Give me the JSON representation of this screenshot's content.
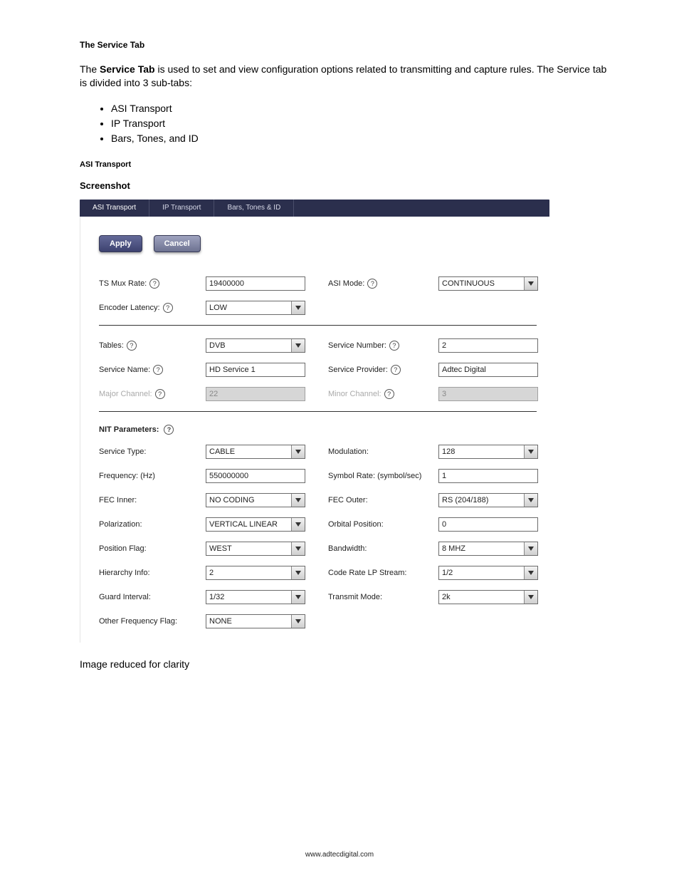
{
  "headings": {
    "section": "The Service Tab",
    "intro_pre": "The ",
    "intro_bold": "Service Tab",
    "intro_post": " is used to set and view configuration options related to transmitting and capture rules. The Service tab is divided into 3 sub-tabs:",
    "subtabs": [
      "ASI Transport",
      "IP Transport",
      "Bars, Tones, and ID"
    ],
    "subheading": "ASI Transport",
    "screenshot": "Screenshot",
    "caption": "Image reduced for clarity"
  },
  "tabs": {
    "asi": "ASI Transport",
    "ip": "IP Transport",
    "bars": "Bars, Tones & ID"
  },
  "buttons": {
    "apply": "Apply",
    "cancel": "Cancel"
  },
  "block1": {
    "ts_mux_rate": {
      "label": "TS Mux Rate:",
      "value": "19400000"
    },
    "asi_mode": {
      "label": "ASI Mode:",
      "value": "CONTINUOUS"
    },
    "encoder_latency": {
      "label": "Encoder Latency:",
      "value": "LOW"
    }
  },
  "block2": {
    "tables": {
      "label": "Tables:",
      "value": "DVB"
    },
    "service_number": {
      "label": "Service Number:",
      "value": "2"
    },
    "service_name": {
      "label": "Service Name:",
      "value": "HD Service 1"
    },
    "service_provider": {
      "label": "Service Provider:",
      "value": "Adtec Digital"
    },
    "major_channel": {
      "label": "Major Channel:",
      "value": "22"
    },
    "minor_channel": {
      "label": "Minor Channel:",
      "value": "3"
    }
  },
  "nit_title": "NIT Parameters:",
  "nit": {
    "service_type": {
      "label": "Service Type:",
      "value": "CABLE"
    },
    "modulation": {
      "label": "Modulation:",
      "value": "128"
    },
    "frequency": {
      "label": "Frequency: (Hz)",
      "value": "550000000"
    },
    "symbol_rate": {
      "label": "Symbol Rate: (symbol/sec)",
      "value": "1"
    },
    "fec_inner": {
      "label": "FEC Inner:",
      "value": "NO CODING"
    },
    "fec_outer": {
      "label": "FEC Outer:",
      "value": "RS (204/188)"
    },
    "polarization": {
      "label": "Polarization:",
      "value": "VERTICAL LINEAR"
    },
    "orbital_position": {
      "label": "Orbital Position:",
      "value": "0"
    },
    "position_flag": {
      "label": "Position Flag:",
      "value": "WEST"
    },
    "bandwidth": {
      "label": "Bandwidth:",
      "value": "8 MHZ"
    },
    "hierarchy": {
      "label": "Hierarchy Info:",
      "value": "2"
    },
    "code_rate_lp": {
      "label": "Code Rate LP Stream:",
      "value": "1/2"
    },
    "guard_interval": {
      "label": "Guard Interval:",
      "value": "1/32"
    },
    "transmit_mode": {
      "label": "Transmit Mode:",
      "value": "2k"
    },
    "other_freq": {
      "label": "Other Frequency Flag:",
      "value": "NONE"
    }
  },
  "footer": "www.adtecdigital.com"
}
